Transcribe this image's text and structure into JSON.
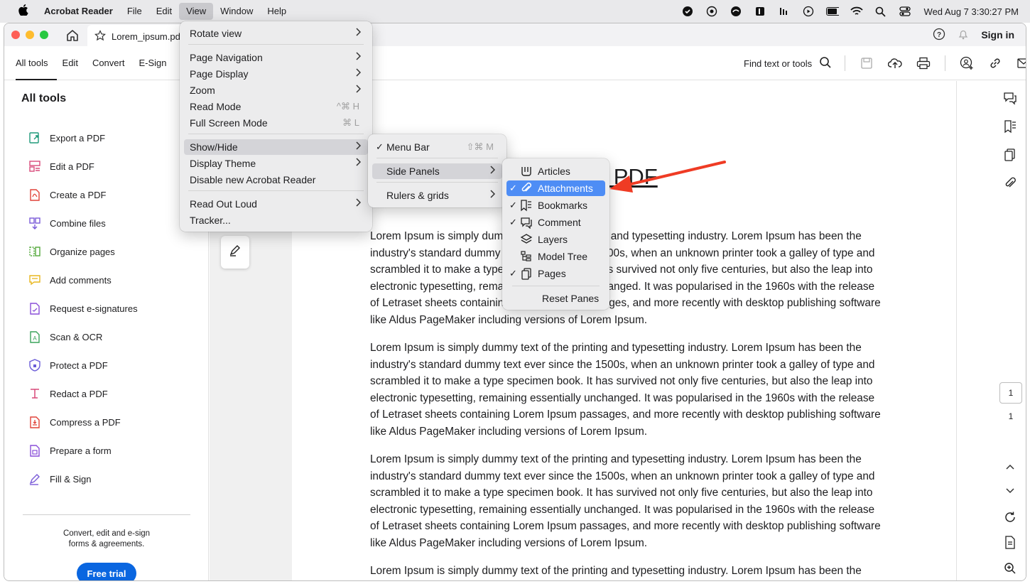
{
  "menubar": {
    "app": "Acrobat Reader",
    "items": [
      "File",
      "Edit",
      "View",
      "Window",
      "Help"
    ],
    "clock": "Wed Aug 7  3:30:27 PM"
  },
  "titlebar": {
    "tab_title": "Lorem_ipsum.pd",
    "sign_in": "Sign in"
  },
  "toolbar": {
    "tabs": [
      "All tools",
      "Edit",
      "Convert",
      "E-Sign"
    ],
    "find": "Find text or tools"
  },
  "sidebar": {
    "title": "All tools",
    "tools": [
      {
        "label": "Export a PDF",
        "color": "#1f9a7a"
      },
      {
        "label": "Edit a PDF",
        "color": "#d94a7a"
      },
      {
        "label": "Create a PDF",
        "color": "#e0433a"
      },
      {
        "label": "Combine files",
        "color": "#7a5bd8"
      },
      {
        "label": "Organize pages",
        "color": "#52a83a"
      },
      {
        "label": "Add comments",
        "color": "#e8b71e"
      },
      {
        "label": "Request e-signatures",
        "color": "#8a4fd8"
      },
      {
        "label": "Scan & OCR",
        "color": "#3aa35a"
      },
      {
        "label": "Protect a PDF",
        "color": "#6a5bd8"
      },
      {
        "label": "Redact a PDF",
        "color": "#d94a7a"
      },
      {
        "label": "Compress a PDF",
        "color": "#e0433a"
      },
      {
        "label": "Prepare a form",
        "color": "#8a4fd8"
      },
      {
        "label": "Fill & Sign",
        "color": "#7a5bd8"
      }
    ],
    "promo_line1": "Convert, edit and e-sign",
    "promo_line2": "forms & agreements.",
    "trial_button": "Free trial"
  },
  "document": {
    "title_fragment": "st PDF",
    "paragraphs": [
      "Lorem Ipsum is simply dummy text of the printing and typesetting industry. Lorem Ipsum has been the industry's standard dummy text ever since the 1500s, when an unknown printer took a galley of type and scrambled it to make a type specimen book. It has survived not only five centuries, but also the leap into electronic typesetting, remaining essentially unchanged. It was popularised in the 1960s with the release of Letraset sheets containing Lorem Ipsum passages, and more recently with desktop publishing software like Aldus PageMaker including versions of Lorem Ipsum.",
      "Lorem Ipsum is simply dummy text of the printing and typesetting industry. Lorem Ipsum has been the industry's standard dummy text ever since the 1500s, when an unknown printer took a galley of type and scrambled it to make a type specimen book. It has survived not only five centuries, but also the leap into electronic typesetting, remaining essentially unchanged. It was popularised in the 1960s with the release of Letraset sheets containing Lorem Ipsum passages, and more recently with desktop publishing software like Aldus PageMaker including versions of Lorem Ipsum.",
      "Lorem Ipsum is simply dummy text of the printing and typesetting industry. Lorem Ipsum has been the industry's standard dummy text ever since the 1500s, when an unknown printer took a galley of type and scrambled it to make a type specimen book. It has survived not only five centuries, but also the leap into electronic typesetting, remaining essentially unchanged. It was popularised in the 1960s with the release of Letraset sheets containing Lorem Ipsum passages, and more recently with desktop publishing software like Aldus PageMaker including versions of Lorem Ipsum.",
      "Lorem Ipsum is simply dummy text of the printing and typesetting industry. Lorem Ipsum has been the industry's standard dummy text ever since the 1500s, when an unknown printer took a galley of type and scrambled it to make a type specimen book. It has survived not only five centuries, but also the leap"
    ]
  },
  "rail": {
    "current_page": "1",
    "total_pages": "1"
  },
  "view_menu": {
    "items": [
      {
        "label": "Rotate view",
        "shortcut": "",
        "submenu": true
      },
      {
        "label": "Page Navigation",
        "shortcut": "",
        "submenu": true
      },
      {
        "label": "Page Display",
        "shortcut": "",
        "submenu": true
      },
      {
        "label": "Zoom",
        "shortcut": "",
        "submenu": true
      },
      {
        "label": "Read Mode",
        "shortcut": "^⌘ H",
        "submenu": false
      },
      {
        "label": "Full Screen Mode",
        "shortcut": "⌘ L",
        "submenu": false
      },
      {
        "label": "Show/Hide",
        "shortcut": "",
        "submenu": true
      },
      {
        "label": "Display Theme",
        "shortcut": "",
        "submenu": true
      },
      {
        "label": "Disable new Acrobat Reader",
        "shortcut": "",
        "submenu": false
      },
      {
        "label": "Read Out Loud",
        "shortcut": "",
        "submenu": true
      },
      {
        "label": "Tracker...",
        "shortcut": "",
        "submenu": false
      }
    ]
  },
  "showhide_menu": {
    "items": [
      {
        "label": "Menu Bar",
        "shortcut": "⇧⌘ M",
        "checked": true
      },
      {
        "label": "Side Panels",
        "shortcut": "",
        "checked": false
      },
      {
        "label": "Rulers & grids",
        "shortcut": "",
        "checked": false
      }
    ]
  },
  "sidepanels_menu": {
    "items": [
      {
        "label": "Articles",
        "checked": false,
        "icon": "articles-icon"
      },
      {
        "label": "Attachments",
        "checked": true,
        "icon": "paperclip-icon"
      },
      {
        "label": "Bookmarks",
        "checked": true,
        "icon": "bookmarks-icon"
      },
      {
        "label": "Comment",
        "checked": true,
        "icon": "comment-icon"
      },
      {
        "label": "Layers",
        "checked": false,
        "icon": "layers-icon"
      },
      {
        "label": "Model Tree",
        "checked": false,
        "icon": "model-tree-icon"
      },
      {
        "label": "Pages",
        "checked": true,
        "icon": "pages-icon"
      }
    ],
    "reset": "Reset Panes"
  },
  "colors": {
    "accent": "#0a66e0",
    "menu_selection": "#4e8df5",
    "annotation_arrow": "#ef3b24"
  }
}
